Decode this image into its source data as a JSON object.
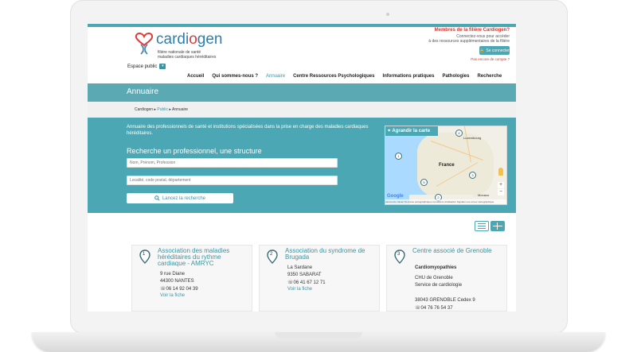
{
  "site": {
    "logo_word_a": "cardi",
    "logo_word_b": "o",
    "logo_word_c": "gen",
    "logo_sub1": "filière nationale de santé",
    "logo_sub2": "maladies cardiaques héréditaires"
  },
  "members": {
    "title": "Membres de la filière Cardiogen?",
    "text1": "Connectez-vous pour accéder",
    "text2": "à des ressources supplémentaires de la filière",
    "login_label": "Se connecter",
    "no_account": "Pas encore de compte ?"
  },
  "espace": {
    "label": "Espace public"
  },
  "nav": [
    "Accueil",
    "Qui sommes-nous ?",
    "Annuaire",
    "Centre Ressources Psychologiques",
    "Informations pratiques",
    "Pathologies",
    "Recherche"
  ],
  "page": {
    "title": "Annuaire"
  },
  "breadcrumb": {
    "home": "Cardiogen",
    "sep1": "▸",
    "public": "Public",
    "sep2": "▸",
    "current": "Annuaire"
  },
  "search": {
    "intro": "Annuaire des professionnels de santé et institutions spécialisées dans la prise en charge des maladies cardiaques héréditaires.",
    "title": "Recherche un professionnel, une structure",
    "name_placeholder": "Nom, Prénom, Profession",
    "place_placeholder": "Localité, code postal, département",
    "button": "Lancez la recherche"
  },
  "map": {
    "enlarge": "Agrandir la carte",
    "country": "France",
    "city1": "Luxembourg",
    "city2": "Monaco",
    "google": "Google",
    "footer": "raccourcis clavier   Données cartographiques   Conditions d'utilisation   Signaler une erreur cartographique",
    "pins": [
      "1",
      "2",
      "3",
      "4",
      "5"
    ]
  },
  "cards": [
    {
      "num": "1",
      "title": "Association des maladies héréditaires du rythme cardiaque - AMRYC",
      "addr1": "9 rue Diane",
      "addr2": "44300 NANTES",
      "phone": "06 14 92 04 39",
      "link": "Voir la fiche"
    },
    {
      "num": "2",
      "title": "Association du syndrome de Brugada",
      "addr1": "La Sardane",
      "addr2": "9350 SABARAT",
      "phone": "06 41 67 12 71",
      "link": "Voir la fiche"
    },
    {
      "num": "3",
      "title": "Centre associé de Grenoble",
      "subtitle": "Cardiomyopathies",
      "addr1": "CHU de Grenoble",
      "addr2": "Service de cardiologie",
      "addr3": "38043 GRENOBLE Cedex 9",
      "phone": "04 76 76 54 37"
    }
  ],
  "colors": {
    "accent": "#4aa7b3",
    "brand_blue": "#2b7fb0",
    "brand_red": "#e03a3a"
  }
}
